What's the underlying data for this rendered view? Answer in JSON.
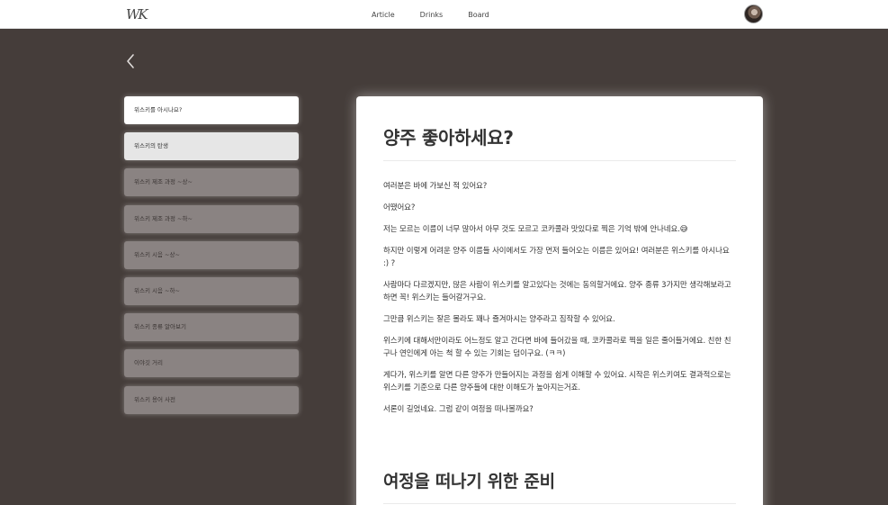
{
  "header": {
    "logo_text": "WK",
    "nav": [
      "Article",
      "Drinks",
      "Board"
    ]
  },
  "sidebar": {
    "items": [
      {
        "label": "위스키를 아시나요?"
      },
      {
        "label": "위스키의 탄생"
      },
      {
        "label": "위스키 제조 과정 ~상~"
      },
      {
        "label": "위스키 제조 과정 ~하~"
      },
      {
        "label": "위스키 시음 ~상~"
      },
      {
        "label": "위스키 시음 ~하~"
      },
      {
        "label": "위스키 종류 알아보기"
      },
      {
        "label": "이야깃 거리"
      },
      {
        "label": "위스키 용어 사전"
      }
    ]
  },
  "article": {
    "title": "양주 좋아하세요?",
    "paragraphs": [
      "여러분은 바에 가보신 적 있어요?",
      "어땠어요?",
      "저는 모르는 이름이 너무 많아서 아무 것도 모르고 코카콜라 맛있다로 찍은 기억 밖에 안나네요.😅",
      "하지만 이렇게 어려운 양주 이름들 사이에서도 가장 먼저 들어오는 이름은 있어요! 여러분은 위스키를 아시나요 :) ?",
      "사람마다 다르겠지만, 많은 사람이 위스키를 알고있다는 것에는 동의할거에요. 양주 종류 3가지만 생각해보라고 하면 꼭! 위스키는 들어갈거구요.",
      "그만큼 위스키는 잘은 몰라도 꽤나 즐겨마시는 양주라고 짐작할 수 있어요.",
      "위스키에 대해서만이라도 어느정도 알고 간다면 바에 들어갔을 때, 코카콜라로 찍을 일은 줄어들거에요. 친한 친구나 연인에게 아는 척 할 수 있는 기회는 덤이구요. (ㅋㅋ)",
      "게다가, 위스키를 알면 다른 양주가 만들어지는 과정을 쉽게 이해할 수 있어요. 시작은 위스키여도 결과적으로는 위스키를 기준으로 다른 양주들에 대한 이해도가 높아지는거죠.",
      "서론이 길었네요. 그럼 같이 여정을 떠나볼까요?"
    ],
    "section2_title": "여정을 떠나기 위한 준비"
  },
  "colors": {
    "background": "#453d3a",
    "card": "#ffffff",
    "sidebar_item": "#8a8382"
  }
}
